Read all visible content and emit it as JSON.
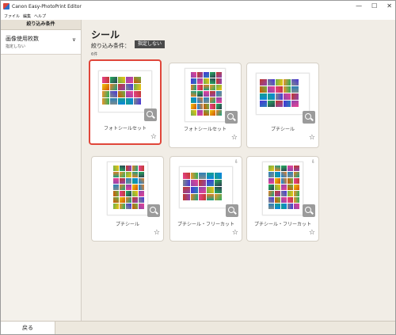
{
  "window": {
    "title": "Canon Easy-PhotoPrint Editor",
    "controls": [
      "—",
      "☐",
      "✕"
    ]
  },
  "menu": [
    "ファイル",
    "編集",
    "ヘルプ"
  ],
  "sidebar": {
    "header": "絞り込み条件",
    "filters": [
      {
        "label": "画像使用枚数",
        "value": "指定しない"
      }
    ]
  },
  "main": {
    "title": "シール",
    "condition_label": "絞り込み条件：",
    "condition_value": "指定しない",
    "count": "6件"
  },
  "cards": [
    {
      "label": "フォトシールセット",
      "selected": true,
      "download": false
    },
    {
      "label": "フォトシールセット",
      "selected": false,
      "download": false
    },
    {
      "label": "プチシール",
      "selected": false,
      "download": false
    },
    {
      "label": "プチシール",
      "selected": false,
      "download": false
    },
    {
      "label": "プチシール・フリーカット",
      "selected": false,
      "download": true
    },
    {
      "label": "プチシール・フリーカット",
      "selected": false,
      "download": true
    }
  ],
  "icons": {
    "star": "☆",
    "cloud": "⇩",
    "chevron": "∨"
  },
  "footer": {
    "back_label": "戻る"
  },
  "colors": {
    "selected_border": "#e0463a",
    "badge_bg": "#4a4a4a"
  }
}
